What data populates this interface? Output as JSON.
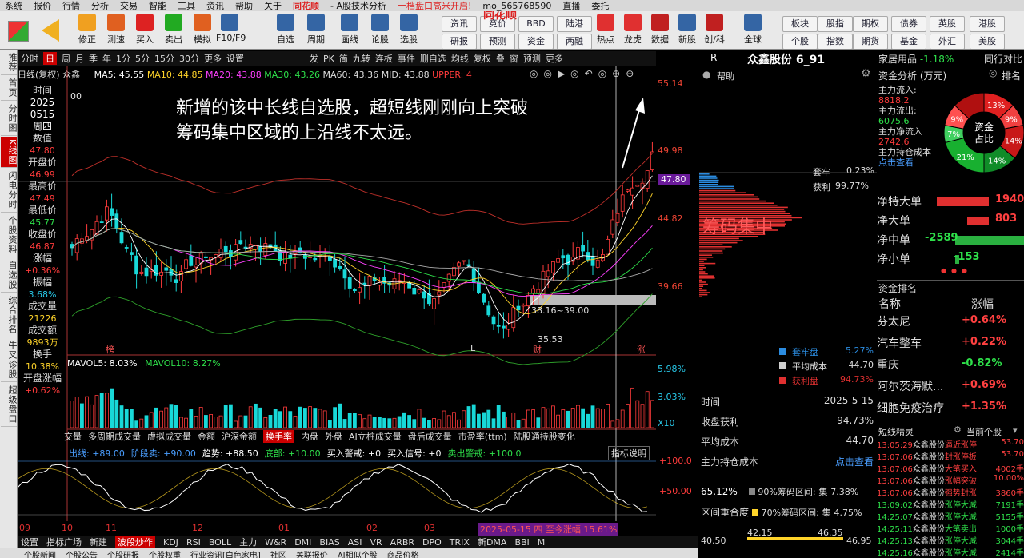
{
  "menu": {
    "items": [
      "系统",
      "报价",
      "行情",
      "分析",
      "交易",
      "智能",
      "工具",
      "资讯",
      "帮助",
      "关于",
      "同花顺",
      "- A股技术分析",
      "十档盘口高米开启!",
      "mo_565768590",
      "直播",
      "委托"
    ]
  },
  "toolbar": {
    "buttons": [
      "修正",
      "测速",
      "买入",
      "卖出",
      "模拟",
      "F10/F9",
      "自选",
      "周期",
      "画线",
      "论股",
      "选股",
      "热点",
      "龙虎",
      "数据",
      "新股",
      "创/科",
      "全球"
    ],
    "grid": [
      "资讯",
      "竞价",
      "BBD",
      "陆港",
      "研报",
      "预测",
      "资金",
      "两融",
      "板块",
      "股指",
      "期权",
      "债券",
      "英股",
      "港股",
      "个股",
      "指数",
      "期货",
      "基金",
      "外汇",
      "美股"
    ],
    "brand": "同花顺"
  },
  "sidebar": {
    "tabs": [
      "推荐",
      "首页",
      "分时图",
      "K线图",
      "闪电分时",
      "个股资料",
      "自选股",
      "综合排名",
      "牛叉诊股",
      "超级盘口"
    ]
  },
  "period_bar": {
    "items": [
      "分时",
      "日",
      "周",
      "月",
      "季",
      "年",
      "1分",
      "5分",
      "15分",
      "30分",
      "更多",
      "设置"
    ],
    "active": "日",
    "tools": [
      "发",
      "PK",
      "简",
      "九转",
      "连板",
      "事件",
      "删自选",
      "均线",
      "复权",
      "叠",
      "窗",
      "预测",
      "更多"
    ]
  },
  "ma_line": {
    "prefix": "日线(复权)",
    "stock": "众鑫",
    "ma5": "MA5: 45.55",
    "ma10": "MA10: 44.85",
    "ma20": "MA20: 43.88",
    "ma30": "MA30: 43.26",
    "ma60": "MA60: 43.36",
    "mid": "MID: 43.88",
    "upper": "UPPER: 4"
  },
  "info": {
    "time_label": "时间",
    "year": "2025",
    "date": "0515",
    "weekday": "周四",
    "value_label": "数值",
    "value": "47.80",
    "open_label": "开盘价",
    "open": "46.99",
    "high_label": "最高价",
    "high": "47.49",
    "low_label": "最低价",
    "low": "45.77",
    "close_label": "收盘价",
    "close": "46.87",
    "chg_label": "涨幅",
    "chg": "+0.36%",
    "amp_label": "振幅",
    "amp": "3.68%",
    "vol_label": "成交量",
    "vol": "21226",
    "amt_label": "成交额",
    "amt": "9893万",
    "turn_label": "换手",
    "turn": "10.38%",
    "open_chg_label": "开盘涨幅",
    "open_chg": "+0.62%"
  },
  "annotation": {
    "line1": "新增的该中长线自选股，超短线刚刚向上突破",
    "line2": "筹码集中区域的上沿线不太远。"
  },
  "chart_labels": {
    "range_label": "38.16~39.00",
    "low_price": "35.53",
    "markers": [
      "榜",
      "L",
      "财",
      "涨"
    ],
    "chip_label": "筹码集中",
    "high_marker": "00"
  },
  "price_axis": {
    "ticks": [
      "55.14",
      "49.98",
      "47.80",
      "44.82",
      "39.66"
    ]
  },
  "volume": {
    "ma5": "MAVOL5: 8.03%",
    "ma10": "MAVOL10: 8.27%",
    "axis": [
      "5.98%",
      "3.03%",
      "X10"
    ]
  },
  "indicator_tabs": {
    "items": [
      "交量",
      "多周期成交量",
      "虚拟成交量",
      "金额",
      "沪深金额",
      "换手率",
      "内盘",
      "外盘",
      "AI立桩成交量",
      "盘后成交量",
      "市盈率(ttm)",
      "陆股通持股变化"
    ],
    "active": "换手率"
  },
  "oscillator": {
    "header": [
      "出线: +89.00",
      "阶段卖: +90.00",
      "趋势: +88.50",
      "底部: +10.00",
      "买入警戒: +0",
      "买入信号: +0",
      "卖出警戒: +100.0"
    ],
    "explain": "指标说明",
    "axis": [
      "+100.0",
      "+50.00"
    ]
  },
  "date_axis": {
    "labels": [
      "09",
      "10",
      "11",
      "12",
      "01",
      "02",
      "03"
    ],
    "tooltip": "2025-05-15 四 至今涨幅 15.61%"
  },
  "bottom_bar": {
    "items": [
      "设置",
      "指标广场",
      "新建",
      "波段炒作",
      "KDJ",
      "RSI",
      "BOLL",
      "主力",
      "W&R",
      "DMI",
      "BIAS",
      "ASI",
      "VR",
      "ARBR",
      "DPO",
      "TRIX",
      "新DMA",
      "BBI",
      "M"
    ],
    "active": "波段炒作"
  },
  "news_bar": {
    "items": [
      "个股新闻",
      "个股公告",
      "个股研报",
      "个股权重",
      "行业资讯[白色家电]",
      "社区",
      "关联报价",
      "AI相似个股",
      "商品价格"
    ]
  },
  "chip": {
    "header": "R",
    "title": "众鑫股份 6_91",
    "help": "帮助",
    "trap_label": "套牢",
    "trap_value": "0.23%",
    "profit_label": "获利",
    "profit_value": "99.77%",
    "legend": [
      {
        "name": "套牢盘",
        "value": "5.27%",
        "color": "#2b8ce0"
      },
      {
        "name": "平均成本",
        "value": "44.70",
        "color": "#cfcfcf"
      },
      {
        "name": "获利盘",
        "value": "94.73%",
        "color": "#e03030"
      }
    ],
    "stats": [
      {
        "label": "时间",
        "value": "2025-5-15"
      },
      {
        "label": "收盘获利",
        "value": "94.73%"
      },
      {
        "label": "平均成本",
        "value": "44.70"
      },
      {
        "label": "主力持仓成本",
        "value": "点击查看"
      }
    ],
    "range90": {
      "pct": "65.12%",
      "label": "90%筹码区间:",
      "tail": "集",
      "conc": "7.38%"
    },
    "range70": {
      "label": "区间重合度",
      "label2": "70%筹码区间:",
      "tail": "集",
      "conc": "4.75%"
    },
    "bottom_prices": [
      "40.50",
      "42.15",
      "46.35",
      "46.95"
    ]
  },
  "right": {
    "title": "家居用品",
    "title_chg": "-1.18%",
    "link": "同行对比",
    "fund_title": "资金分析 (万元)",
    "rank_label": "排名",
    "inflow_label": "主力流入:",
    "inflow": "8818.2",
    "outflow_label": "主力流出:",
    "outflow": "6075.6",
    "net_label": "主力净流入",
    "net": "2742.6",
    "cost_label": "主力持仓成本",
    "cost_link": "点击查看",
    "pie_center": "资金占比",
    "pie": [
      {
        "label": "13%",
        "pct": 13,
        "color": "#e02020"
      },
      {
        "label": "9%",
        "pct": 9,
        "color": "#f04040"
      },
      {
        "label": "14%",
        "pct": 14,
        "color": "#c81818"
      },
      {
        "label": "14%",
        "pct": 14,
        "color": "#108c28"
      },
      {
        "label": "21%",
        "pct": 21,
        "color": "#18b030"
      },
      {
        "label": "7%",
        "pct": 7,
        "color": "#40d060"
      },
      {
        "label": "9%",
        "pct": 9,
        "color": "#ff5050"
      },
      {
        "label": "",
        "pct": 13,
        "color": "#b01010"
      }
    ],
    "flows": [
      {
        "label": "净特大单",
        "value": "1940",
        "positive": true,
        "frac": 0.75
      },
      {
        "label": "净大单",
        "value": "803",
        "positive": true,
        "frac": 0.31
      },
      {
        "label": "净中单",
        "value": "-2589",
        "positive": false,
        "frac": 1.0
      },
      {
        "label": "净小单",
        "value": "-153",
        "positive": false,
        "frac": 0.06
      }
    ],
    "rank_title": "资金排名",
    "rank_headers": [
      "名称",
      "涨幅"
    ],
    "rank_rows": [
      {
        "name": "芬太尼",
        "chg": "+0.64%"
      },
      {
        "name": "汽车整车",
        "chg": "+0.22%"
      },
      {
        "name": "重庆",
        "chg": "-0.82%"
      },
      {
        "name": "阿尔茨海默...",
        "chg": "+0.69%"
      },
      {
        "name": "细胞免疫治疗",
        "chg": "+1.35%"
      }
    ],
    "wizard_title": "短线精灵",
    "wizard_scope": "当前个股",
    "wizard_rows": [
      {
        "time": "13:05:29",
        "stock": "众鑫股份",
        "event": "逼近涨停",
        "num": "53.70",
        "up": true
      },
      {
        "time": "13:07:06",
        "stock": "众鑫股份",
        "event": "封涨停板",
        "num": "53.70",
        "up": true
      },
      {
        "time": "13:07:06",
        "stock": "众鑫股份",
        "event": "大笔买入",
        "num": "4002手",
        "up": true
      },
      {
        "time": "13:07:06",
        "stock": "众鑫股份",
        "event": "涨幅突破",
        "num": "10.00%",
        "up": true
      },
      {
        "time": "13:07:06",
        "stock": "众鑫股份",
        "event": "强势封涨",
        "num": "3860手",
        "up": true
      },
      {
        "time": "13:09:02",
        "stock": "众鑫股份",
        "event": "涨停大减",
        "num": "7191手",
        "up": false
      },
      {
        "time": "14:25:07",
        "stock": "众鑫股份",
        "event": "涨停大减",
        "num": "5155手",
        "up": false
      },
      {
        "time": "14:25:11",
        "stock": "众鑫股份",
        "event": "大笔卖出",
        "num": "1000手",
        "up": false
      },
      {
        "time": "14:25:13",
        "stock": "众鑫股份",
        "event": "涨停大减",
        "num": "3044手",
        "up": false
      },
      {
        "time": "14:25:16",
        "stock": "众鑫股份",
        "event": "涨停大减",
        "num": "2414手",
        "up": false
      }
    ]
  },
  "colors": {
    "up": "#ff3b3b",
    "down": "#2ee04a",
    "accent": "#c00000"
  }
}
